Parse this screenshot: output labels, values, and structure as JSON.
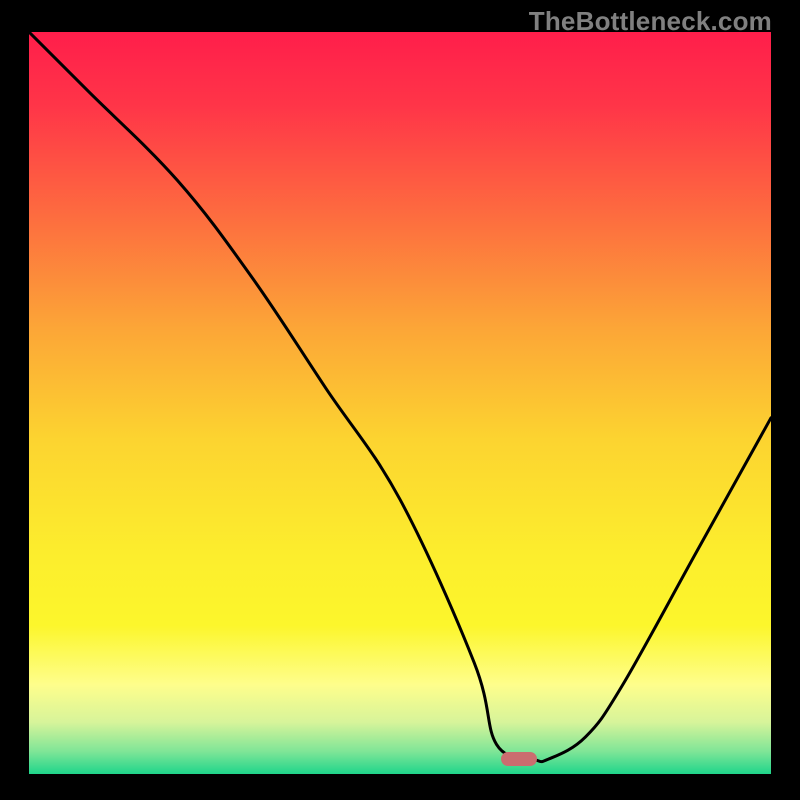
{
  "watermark": "TheBottleneck.com",
  "chart_data": {
    "type": "line",
    "title": "",
    "xlabel": "",
    "ylabel": "",
    "xlim": [
      0,
      100
    ],
    "ylim": [
      0,
      100
    ],
    "series": [
      {
        "name": "curve",
        "x": [
          0,
          8,
          20,
          30,
          40,
          50,
          60,
          63,
          68,
          70,
          75,
          80,
          90,
          100
        ],
        "values": [
          100,
          92,
          80,
          67,
          52,
          37,
          15,
          4,
          2,
          2,
          5,
          12,
          30,
          48
        ]
      }
    ],
    "background_gradient": {
      "stops": [
        {
          "pos": 0.0,
          "color": "#FF1E4B"
        },
        {
          "pos": 0.1,
          "color": "#FF3548"
        },
        {
          "pos": 0.25,
          "color": "#FD6D3F"
        },
        {
          "pos": 0.4,
          "color": "#FCA637"
        },
        {
          "pos": 0.55,
          "color": "#FCD430"
        },
        {
          "pos": 0.7,
          "color": "#FCED2D"
        },
        {
          "pos": 0.8,
          "color": "#FCF62C"
        },
        {
          "pos": 0.88,
          "color": "#FEFE8C"
        },
        {
          "pos": 0.93,
          "color": "#D7F49A"
        },
        {
          "pos": 0.97,
          "color": "#7EE597"
        },
        {
          "pos": 1.0,
          "color": "#1FD58B"
        }
      ]
    },
    "marker": {
      "x": 66,
      "y": 2,
      "color": "#CB6D6F"
    },
    "curve_color": "#000000"
  }
}
